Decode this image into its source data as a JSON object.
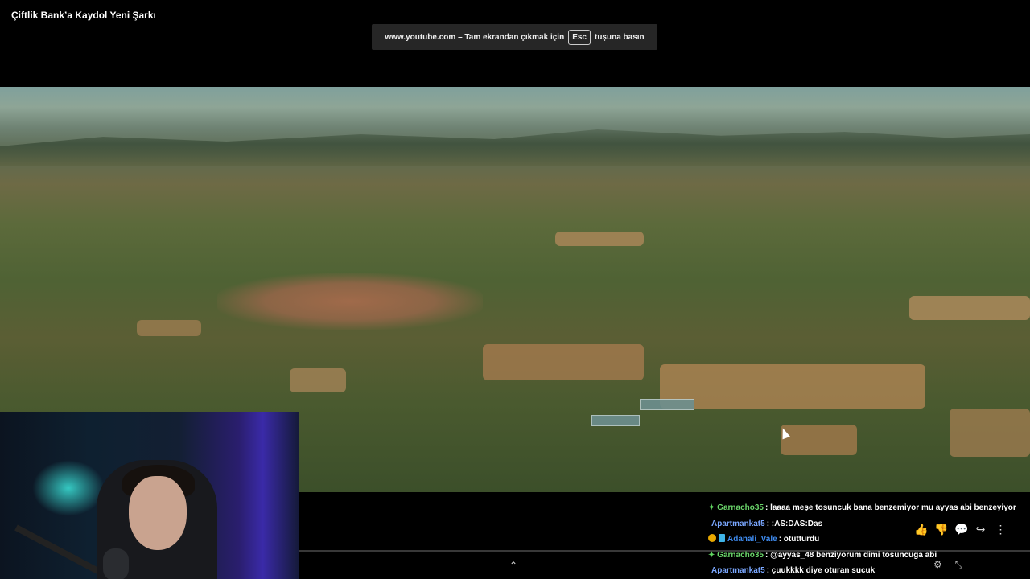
{
  "video": {
    "title": "Çiftlik Bank’a Kaydol Yeni Şarkı"
  },
  "fullscreen_notice": {
    "prefix": "www.youtube.com – Tam ekrandan çıkmak için",
    "key": "Esc",
    "suffix": "tuşuna basın"
  },
  "chat": {
    "messages": [
      {
        "badge": "green-diamond",
        "user": "Garnacho35",
        "user_color": "#6ad46a",
        "text": ": laaaa meşe tosuncuk bana benzemiyor mu ayyas abi benzeyiyor"
      },
      {
        "badge": "",
        "user": "Apartmankat5",
        "user_color": "#7aa7ff",
        "text": ": :AS:DAS:Das"
      },
      {
        "badge": "sub-badges",
        "user": "Adanali_Vale",
        "user_color": "#3f8cf0",
        "text": ": otutturdu"
      },
      {
        "badge": "green-diamond",
        "user": "Garnacho35",
        "user_color": "#6ad46a",
        "text": ": @ayyas_48 benziyorum dimi tosuncuga abi"
      },
      {
        "badge": "",
        "user": "Apartmankat5",
        "user_color": "#7aa7ff",
        "text": ": çuukkkk diye oturan sucuk"
      }
    ]
  },
  "player_actions": {
    "like": "👍",
    "dislike": "👎",
    "comment": "💬",
    "share": "↪",
    "more": "⋮",
    "expand": "⌃",
    "settings": "⚙",
    "exit_fullscreen": "⤡"
  }
}
